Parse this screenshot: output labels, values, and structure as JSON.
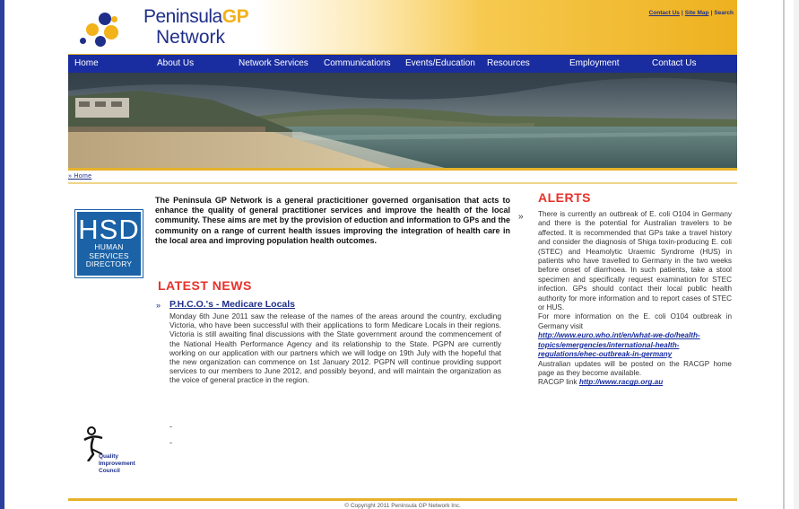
{
  "header": {
    "logo_line1": "Peninsula",
    "logo_gp": "GP",
    "logo_line2": "Network",
    "util_links": [
      "Contact Us",
      "Site Map",
      "Search"
    ],
    "util_sep": "|",
    "brand_blue": "#1e2f8a",
    "brand_gold": "#f2b21a"
  },
  "nav": {
    "items": [
      "Home",
      "About Us",
      "Network Services",
      "Communications",
      "Events/Education",
      "Resources",
      "Employment",
      "Contact Us"
    ],
    "background": "#1a2da0"
  },
  "breadcrumb": "» Home",
  "hsd": {
    "big": "HSD",
    "line1": "HUMAN",
    "line2": "SERVICES",
    "line3": "DIRECTORY"
  },
  "qic": {
    "line1": "Quality",
    "line2": "Improvement",
    "line3": "Council"
  },
  "intro": "The Peninsula GP Network is a general practicitioner governed organisation that acts to enhance the quality of general practitioner services and improve the health of the local community. These aims are met by the provision of eduction and information to GPs and the community on a range of current health issues improving the integration of health care in the local area and improving population health outcomes.",
  "bullet": "»",
  "latest_news": {
    "heading": "LATEST NEWS",
    "arrow": "»",
    "title": "P.H.C.O.'s - Medicare Locals",
    "body": "Monday 6th June 2011 saw the release of the names of the areas around the country, excluding Victoria, who have been successful with their applications to form Medicare Locals in their regions. Victoria is still awaiting final discussions with the State government around the commencement of the National Health Performance Agency and its relationship to the State. PGPN are currently working on our application with our partners which we will lodge on 19th July with the hopeful that the new organization can commence on 1st January 2012. PGPN will continue providing support services to our members to June 2012, and possibly beyond, and will maintain the organization as the voice of general practice in the region.",
    "dash1": "-",
    "dash2": "-"
  },
  "alerts": {
    "heading": "ALERTS",
    "body1": "There is currently an outbreak of E. coli O104 in Germany and there is the potential for Australian travelers to be affected. It is recommended that GPs take a travel history and consider the diagnosis of Shiga toxin-producing E. coli (STEC) and Heamolytic Uraemic Syndrome (HUS) in patients who have travelled to Germany in the two weeks before onset of diarrhoea. In such patients, take a stool specimen and specifically request examination for STEC infection. GPs should contact their local public health authority for more information and to report cases of STEC or HUS.",
    "body2": "For more information on the E. coli O104 outbreak in Germany visit",
    "who_link": "http://www.euro.who.int/en/what-we-do/health-topics/emergencies/international-health-regulations/ehec-outbreak-in-germany",
    "body3": "Australian updates will be posted on the RACGP home page as they become available.",
    "racgp_prefix": "RACGP link",
    "racgp_link": "http://www.racgp.org.au",
    "alert_red": "#e8312a"
  },
  "footer": "© Copyright 2011 Peninsula GP Network Inc."
}
